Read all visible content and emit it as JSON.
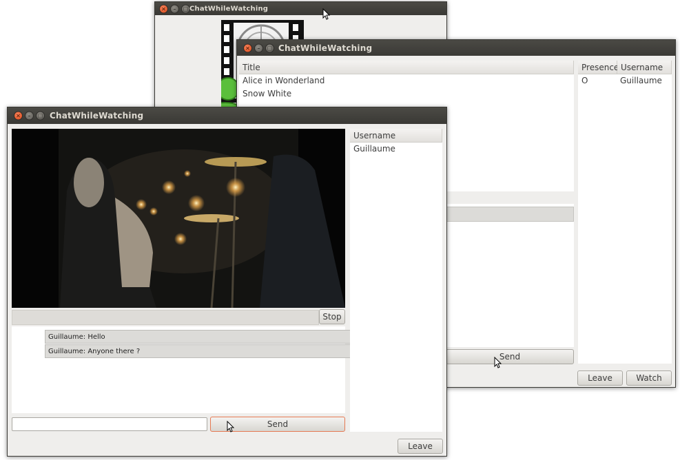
{
  "back_window": {
    "title": "ChatWhileWatching"
  },
  "mid_window": {
    "title": "ChatWhileWatching",
    "videos": {
      "header": "Title",
      "rows": [
        "Alice in Wonderland",
        "Snow White"
      ]
    },
    "presence": {
      "headers": [
        "Presence",
        "Username"
      ],
      "rows": [
        {
          "presence": "O",
          "username": "Guillaume"
        }
      ]
    },
    "send_label": "Send",
    "leave_label": "Leave",
    "watch_label": "Watch"
  },
  "front_window": {
    "title": "ChatWhileWatching",
    "stop_label": "Stop",
    "messages": [
      "Guillaume: Hello",
      "Guillaume: Anyone there ?"
    ],
    "input_value": "",
    "send_label": "Send",
    "users": {
      "header": "Username",
      "rows": [
        "Guillaume"
      ]
    },
    "leave_label": "Leave"
  }
}
